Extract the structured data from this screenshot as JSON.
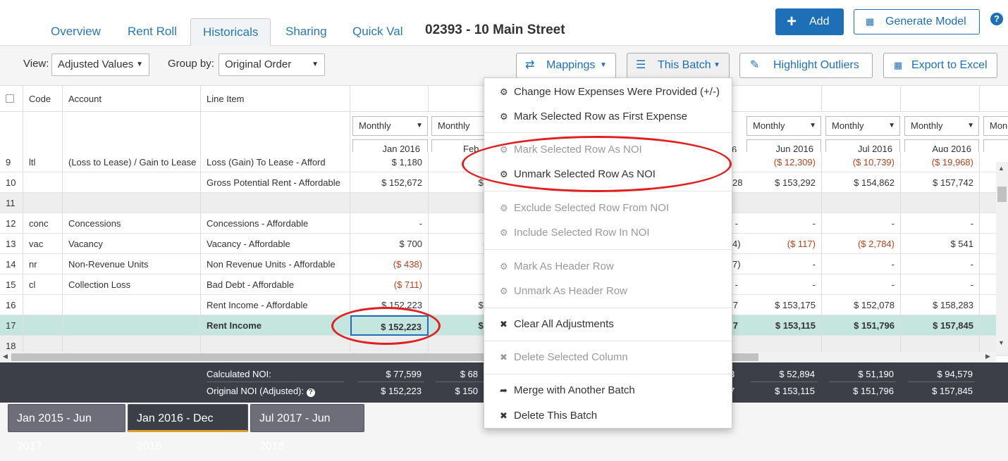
{
  "tabs": [
    "Overview",
    "Rent Roll",
    "Historicals",
    "Sharing",
    "Quick Val"
  ],
  "property_title": "02393 - 10 Main Street",
  "add_label": "Add",
  "generate_label": "Generate Model",
  "toolbar": {
    "view_label": "View:",
    "view_value": "Adjusted Values",
    "group_label": "Group by:",
    "group_value": "Original Order",
    "mappings": "Mappings",
    "batch": "This Batch",
    "outliers": "Highlight Outliers",
    "export": "Export to Excel"
  },
  "grid": {
    "headers": [
      "Code",
      "Account",
      "Line Item"
    ],
    "freq": "Monthly",
    "months": [
      "Jan 2016",
      "Feb 2016",
      "",
      "",
      "",
      "Jun 2016",
      "Jul 2016",
      "Aug 2016"
    ],
    "rows": [
      {
        "n": "9",
        "code": "ltl",
        "acct": "(Loss to Lease) / Gain to Lease",
        "item": "Loss (Gain) To Lease - Afford",
        "v": [
          "$ 1,180",
          "$ 1",
          "",
          "($ 12,309)",
          "($ 10,739)",
          "($ 19,968)"
        ]
      },
      {
        "n": "10",
        "code": "",
        "acct": "",
        "item": "Gross Potential Rent - Affordable",
        "v": [
          "$ 152,672",
          "$ 152",
          "28",
          "$ 153,292",
          "$ 154,862",
          "$ 157,742"
        ]
      },
      {
        "n": "11",
        "code": "",
        "acct": "",
        "item": "",
        "v": [
          "",
          "",
          "",
          "",
          "",
          ""
        ]
      },
      {
        "n": "12",
        "code": "conc",
        "acct": "Concessions",
        "item": "Concessions - Affordable",
        "v": [
          "-",
          "",
          "-",
          "-",
          "-",
          "-"
        ]
      },
      {
        "n": "13",
        "code": "vac",
        "acct": "Vacancy",
        "item": "Vacancy - Affordable",
        "v": [
          "$ 700",
          "($ 1,",
          "4)",
          "($ 117)",
          "($ 2,784)",
          "$ 541"
        ]
      },
      {
        "n": "14",
        "code": "nr",
        "acct": "Non-Revenue Units",
        "item": "Non Revenue Units - Affordable",
        "v": [
          "($ 438)",
          "($",
          "7)",
          "-",
          "-",
          "-"
        ]
      },
      {
        "n": "15",
        "code": "cl",
        "acct": "Collection Loss",
        "item": "Bad Debt - Affordable",
        "v": [
          "($ 711)",
          "",
          "-",
          "-",
          "-",
          "-"
        ]
      },
      {
        "n": "16",
        "code": "",
        "acct": "",
        "item": "Rent Income - Affordable",
        "v": [
          "$ 152,223",
          "$ 150",
          "7",
          "$ 153,175",
          "$ 152,078",
          "$ 158,283"
        ]
      },
      {
        "n": "17",
        "code": "",
        "acct": "",
        "item": "Rent Income",
        "v": [
          "$ 152,223",
          "$ 150",
          "7",
          "$ 153,115",
          "$ 151,796",
          "$ 157,845"
        ]
      },
      {
        "n": "18",
        "code": "",
        "acct": "",
        "item": "",
        "v": [
          "",
          "",
          "",
          "",
          "",
          ""
        ]
      }
    ]
  },
  "footer": {
    "calc_label": "Calculated NOI:",
    "orig_label": "Original NOI (Adjusted):",
    "calc": [
      "$ 77,599",
      "$ 68",
      "3",
      "$ 52,894",
      "$ 51,190",
      "$ 94,579"
    ],
    "orig": [
      "$ 152,223",
      "$ 150",
      "7",
      "$ 153,115",
      "$ 151,796",
      "$ 157,845"
    ]
  },
  "batches": [
    "Jan 2015 - Jun 2017",
    "Jan 2016 - Dec 2016",
    "Jul 2017 - Jun 2018"
  ],
  "menu": [
    "Change How Expenses Were Provided (+/-)",
    "Mark Selected Row as First Expense",
    "Mark Selected Row As NOI",
    "Unmark Selected Row As NOI",
    "Exclude Selected Row From NOI",
    "Include Selected Row In NOI",
    "Mark As Header Row",
    "Unmark As Header Row",
    "Clear All Adjustments",
    "Delete Selected Column",
    "Merge with Another Batch",
    "Delete This Batch"
  ],
  "colors": {
    "accent": "#1d70b8",
    "negative": "#b0441a",
    "selected_row": "#c5e6df",
    "annotation": "#e02020"
  }
}
